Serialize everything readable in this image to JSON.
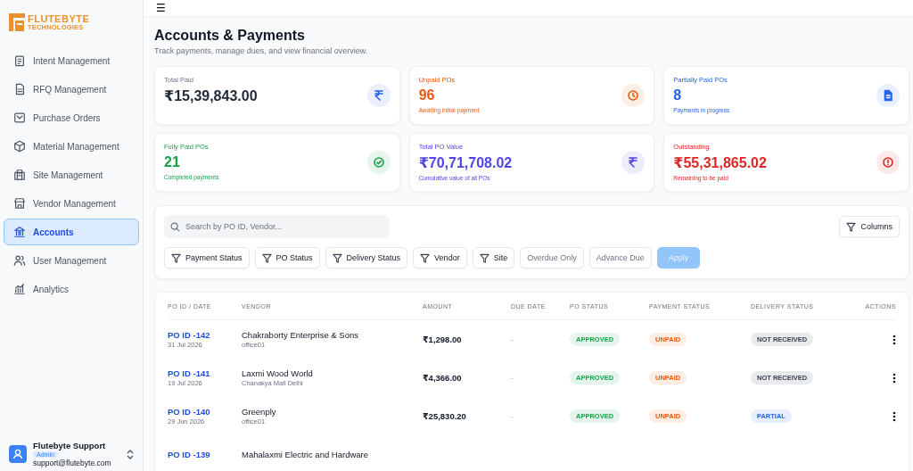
{
  "brand": {
    "name": "FLUTEBYTE",
    "tagline": "TECHNOLOGIES"
  },
  "sidebar": {
    "items": [
      {
        "label": "Intent Management",
        "selected": false
      },
      {
        "label": "RFQ Management",
        "selected": false
      },
      {
        "label": "Purchase Orders",
        "selected": false
      },
      {
        "label": "Material Management",
        "selected": false
      },
      {
        "label": "Site Management",
        "selected": false
      },
      {
        "label": "Vendor Management",
        "selected": false
      },
      {
        "label": "Accounts",
        "selected": true
      },
      {
        "label": "User Management",
        "selected": false
      },
      {
        "label": "Analytics",
        "selected": false
      }
    ],
    "user": {
      "name": "Flutebyte Support",
      "role": "Admin",
      "email": "support@flutebyte.com"
    }
  },
  "topbar": {
    "menu": "☰"
  },
  "page": {
    "title": "Accounts & Payments",
    "subtitle": "Track payments, manage dues, and view financial overview."
  },
  "cards": [
    {
      "label": "Total Paid",
      "value": "₹15,39,843.00",
      "color": "#2563eb"
    },
    {
      "label": "Unpaid POs",
      "value": "96",
      "note": "Awaiting initial payment",
      "color": "#ea580c"
    },
    {
      "label": "Partially Paid POs",
      "value": "8",
      "note": "Payments in progress",
      "color": "#2563eb"
    },
    {
      "label": "Fully Paid POs",
      "value": "21",
      "note": "Completed payments",
      "color": "#16a34a"
    },
    {
      "label": "Total PO Value",
      "value": "₹70,71,708.02",
      "note": "Cumulative value of all POs",
      "color": "#4f46e5"
    },
    {
      "label": "Outstanding",
      "value": "₹55,31,865.02",
      "note": "Remaining to be paid",
      "color": "#dc2626"
    }
  ],
  "search": {
    "placeholder": "Search by PO ID, Vendor..."
  },
  "columns_button": "Columns",
  "filters": [
    {
      "label": "Payment Status",
      "kind": "filter"
    },
    {
      "label": "PO Status",
      "kind": "filter"
    },
    {
      "label": "Delivery Status",
      "kind": "filter"
    },
    {
      "label": "Vendor",
      "kind": "filter"
    },
    {
      "label": "Site",
      "kind": "filter"
    },
    {
      "label": "Overdue Only",
      "kind": "toggle"
    },
    {
      "label": "Advance Due",
      "kind": "toggle"
    },
    {
      "label": "Apply",
      "kind": "apply",
      "disabled": true
    }
  ],
  "table": {
    "columns": [
      "PO ID / DATE",
      "VENDOR",
      "AMOUNT",
      "DUE DATE",
      "PO STATUS",
      "PAYMENT STATUS",
      "DELIVERY STATUS",
      "ACTIONS"
    ],
    "rows": [
      {
        "po": "PO ID -142",
        "date": "31 Jul 2026",
        "vendor": "Chakraborty Enterprise & Sons",
        "site": "office01",
        "amount": "₹1,298.00",
        "due": "-",
        "po_status": {
          "text": "APPROVED",
          "color": "#16a34a"
        },
        "payment_status": {
          "text": "UNPAID",
          "color": "#ea580c"
        },
        "delivery_status": {
          "text": "NOT RECEIVED",
          "color": "#374151"
        }
      },
      {
        "po": "PO ID -141",
        "date": "19 Jul 2026",
        "vendor": "Laxmi Wood World",
        "site": "Chanakya Mall Delhi",
        "amount": "₹4,366.00",
        "due": "-",
        "po_status": {
          "text": "APPROVED",
          "color": "#16a34a"
        },
        "payment_status": {
          "text": "UNPAID",
          "color": "#ea580c"
        },
        "delivery_status": {
          "text": "NOT RECEIVED",
          "color": "#374151"
        }
      },
      {
        "po": "PO ID -140",
        "date": "29 Jun 2026",
        "vendor": "Greenply",
        "site": "office01",
        "amount": "₹25,830.20",
        "due": "-",
        "po_status": {
          "text": "APPROVED",
          "color": "#16a34a"
        },
        "payment_status": {
          "text": "UNPAID",
          "color": "#ea580c"
        },
        "delivery_status": {
          "text": "PARTIAL",
          "color": "#2563eb"
        }
      },
      {
        "po": "PO ID -139",
        "vendor": "Mahalaxmi Electric and Hardware"
      }
    ]
  }
}
